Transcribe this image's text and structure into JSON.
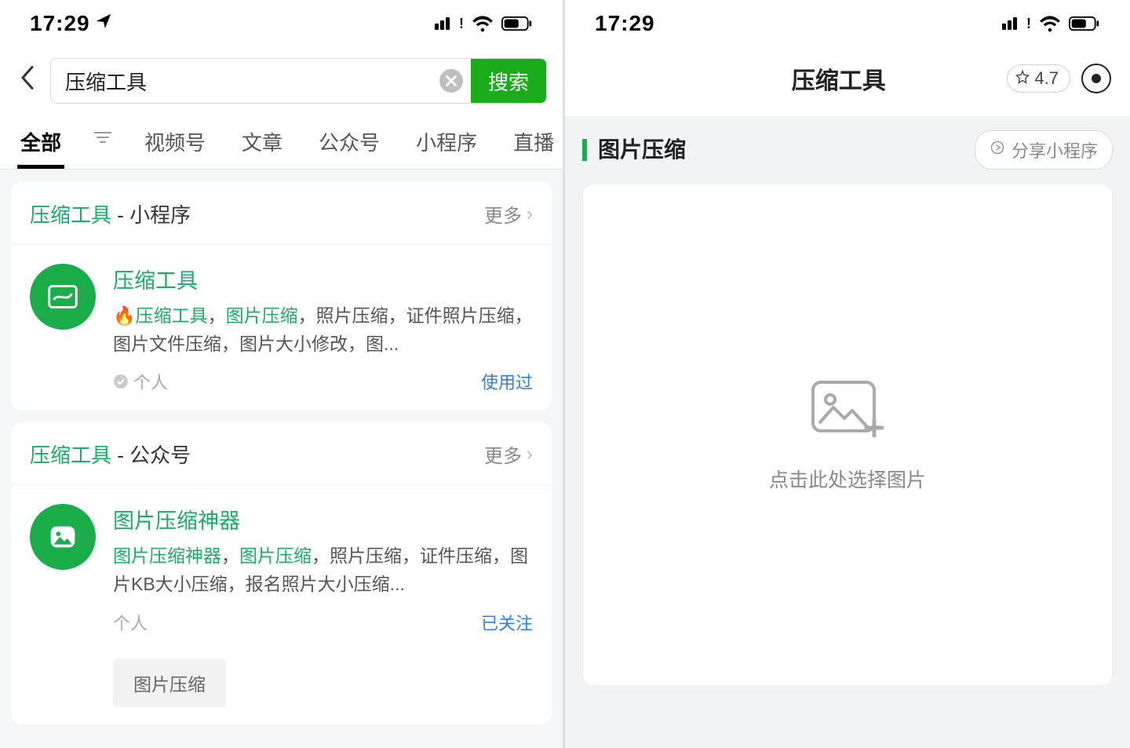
{
  "left": {
    "status": {
      "time": "17:29",
      "has_location": true
    },
    "search": {
      "query": "压缩工具",
      "button_label": "搜索"
    },
    "tabs": [
      "全部",
      "视频号",
      "文章",
      "公众号",
      "小程序",
      "直播"
    ],
    "active_tab": 0,
    "sections": [
      {
        "keyword": "压缩工具",
        "suffix": " - 小程序",
        "more": "更多",
        "result": {
          "title": "压缩工具",
          "desc_pre": "🔥",
          "desc_kw1": "压缩工具",
          "desc_mid1": "，",
          "desc_kw2": "图片压缩",
          "desc_rest": "，照片压缩，证件照片压缩，图片文件压缩，图片大小修改，图...",
          "source": "个人",
          "verified": true,
          "badge": "使用过"
        }
      },
      {
        "keyword": "压缩工具",
        "suffix": " - 公众号",
        "more": "更多",
        "result": {
          "title": "图片压缩神器",
          "desc_kw1": "图片压缩神器",
          "desc_mid1": "，",
          "desc_kw2": "图片压缩",
          "desc_rest": "，照片压缩，证件压缩，图片KB大小压缩，报名照片大小压缩...",
          "source": "个人",
          "verified": false,
          "badge": "已关注",
          "chip": "图片压缩"
        }
      }
    ]
  },
  "right": {
    "status": {
      "time": "17:29",
      "has_location": false
    },
    "title": "压缩工具",
    "rating": "4.7",
    "section_title": "图片压缩",
    "share_label": "分享小程序",
    "upload_hint": "点击此处选择图片"
  }
}
